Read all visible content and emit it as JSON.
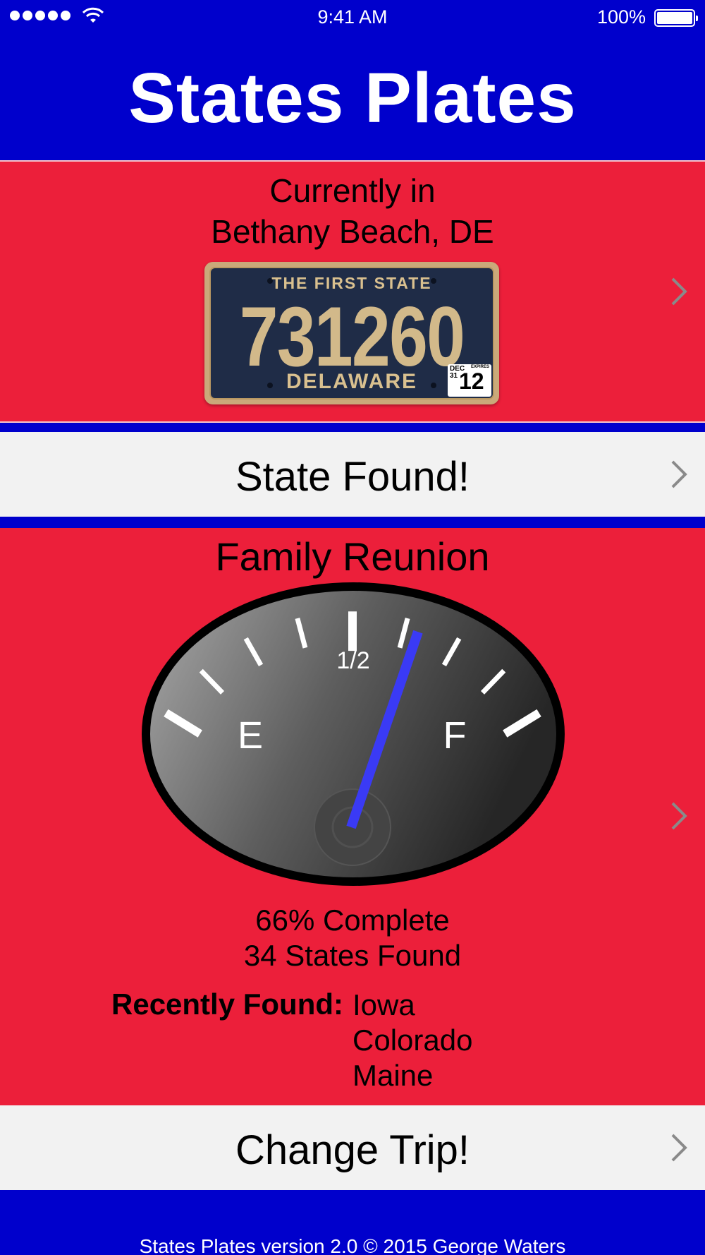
{
  "status_bar": {
    "time": "9:41 AM",
    "battery": "100%",
    "signal_icon": "signal-dots-icon",
    "wifi_icon": "wifi-icon",
    "battery_icon": "battery-icon"
  },
  "app_title": "States Plates",
  "location": {
    "line1": "Currently in",
    "line2": "Bethany Beach, DE",
    "plate": {
      "slogan": "THE FIRST STATE",
      "number": "731260",
      "state": "DELAWARE",
      "sticker_month": "DEC 31",
      "sticker_year": "12",
      "sticker_label": "EXPIRES"
    }
  },
  "state_found_label": "State Found!",
  "trip": {
    "name": "Family Reunion",
    "gauge": {
      "empty_label": "E",
      "half_label": "1/2",
      "full_label": "F",
      "fill_fraction": 0.66
    },
    "percent_complete": "66% Complete",
    "states_found": "34 States Found",
    "recently_found_label": "Recently Found:",
    "recently_found": [
      "Iowa",
      "Colorado",
      "Maine"
    ]
  },
  "change_trip_label": "Change Trip!",
  "footer": "States Plates version 2.0 © 2015 George Waters",
  "colors": {
    "blue": "#0000cc",
    "red": "#ec1f3a",
    "gray": "#f2f2f2",
    "needle": "#3a3af5"
  }
}
